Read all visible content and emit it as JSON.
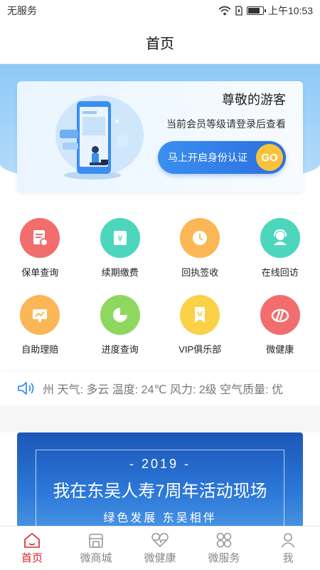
{
  "status_bar": {
    "carrier": "无服务",
    "time": "上午10:53",
    "battery_level": 0.85
  },
  "header": {
    "title": "首页"
  },
  "hero": {
    "greeting": "尊敬的游客",
    "subtitle": "当前会员等级请登录后查看",
    "verify_label": "马上开启身份认证",
    "go_label": "GO"
  },
  "services": [
    {
      "label": "保单查询",
      "icon": "policy-search-icon",
      "color": "#f26d6d"
    },
    {
      "label": "续期缴费",
      "icon": "renewal-payment-icon",
      "color": "#4cd6be"
    },
    {
      "label": "回执签收",
      "icon": "receipt-clock-icon",
      "color": "#fbb655"
    },
    {
      "label": "在线回访",
      "icon": "customer-service-icon",
      "color": "#4cd6be"
    },
    {
      "label": "自助理赔",
      "icon": "self-claim-icon",
      "color": "#fbb655"
    },
    {
      "label": "进度查询",
      "icon": "progress-pie-icon",
      "color": "#8ed860"
    },
    {
      "label": "VIP俱乐部",
      "icon": "vip-club-icon",
      "color": "#fbd146"
    },
    {
      "label": "微健康",
      "icon": "micro-health-icon",
      "color": "#f26d6d"
    }
  ],
  "ticker": {
    "text": "州  天气: 多云  温度: 24℃  风力: 2级  空气质量: 优"
  },
  "banner": {
    "year": "- 2019 -",
    "title": "我在东吴人寿7周年活动现场",
    "slogan": "绿色发展  东吴相伴"
  },
  "tabs": [
    {
      "label": "首页",
      "icon": "home-icon",
      "active": true
    },
    {
      "label": "微商城",
      "icon": "shop-icon",
      "active": false
    },
    {
      "label": "微健康",
      "icon": "heart-pulse-icon",
      "active": false
    },
    {
      "label": "微服务",
      "icon": "services-grid-icon",
      "active": false
    },
    {
      "label": "我",
      "icon": "profile-icon",
      "active": false
    }
  ],
  "colors": {
    "accent": "#d9222a",
    "primary_blue": "#2c6fe0",
    "go_yellow": "#f8c33c"
  }
}
